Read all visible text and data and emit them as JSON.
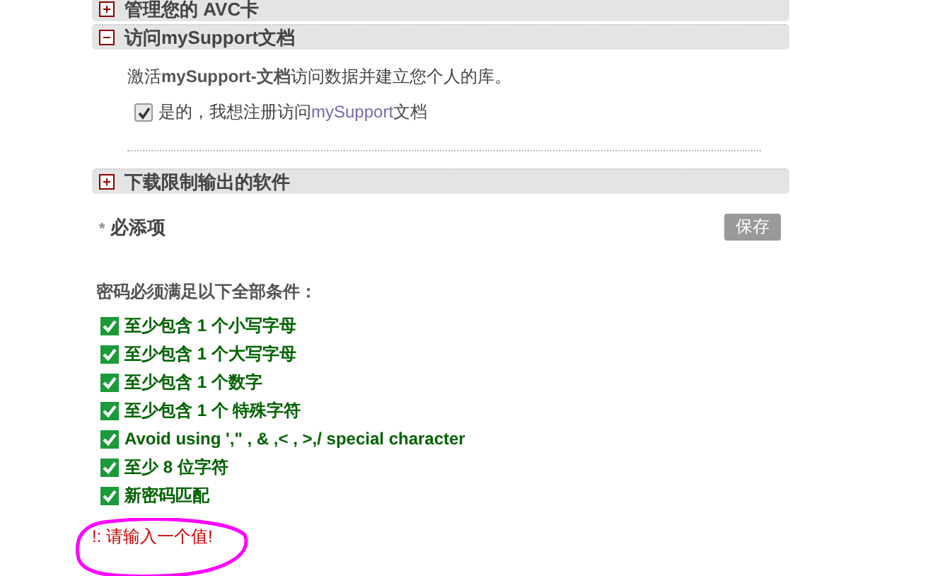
{
  "sections": [
    {
      "title": "管理您的 AVC卡",
      "expanded": false
    },
    {
      "title": "访问mySupport文档",
      "expanded": true,
      "description": "激活**mySupport-文档**访问数据并建立您个人的库。",
      "checkbox": {
        "label": "是的，我想注册访问",
        "link": "mySupport",
        "label_after": "文档",
        "checked": true
      }
    },
    {
      "title": "下载限制输出的软件",
      "expanded": false
    }
  ],
  "required_note": {
    "mark": "*",
    "label": "必添项"
  },
  "save_button": "保存",
  "password_rules": {
    "heading": "密码必须满足以下全部条件：",
    "rules": [
      {
        "text": "至少包含 1 个小写字母",
        "checked": true
      },
      {
        "text": "至少包含 1 个大写字母",
        "checked": true
      },
      {
        "text": "至少包含 1 个数字",
        "checked": true
      },
      {
        "text": "至少包含 1 个 特殊字符",
        "checked": true
      },
      {
        "text": "Avoid using ',\" , & ,< , >,/ special character",
        "checked": true
      },
      {
        "text": "至少 8 位字符",
        "checked": true
      },
      {
        "text": "新密码匹配",
        "checked": true
      }
    ]
  },
  "error": "!: 请输入一个值!"
}
